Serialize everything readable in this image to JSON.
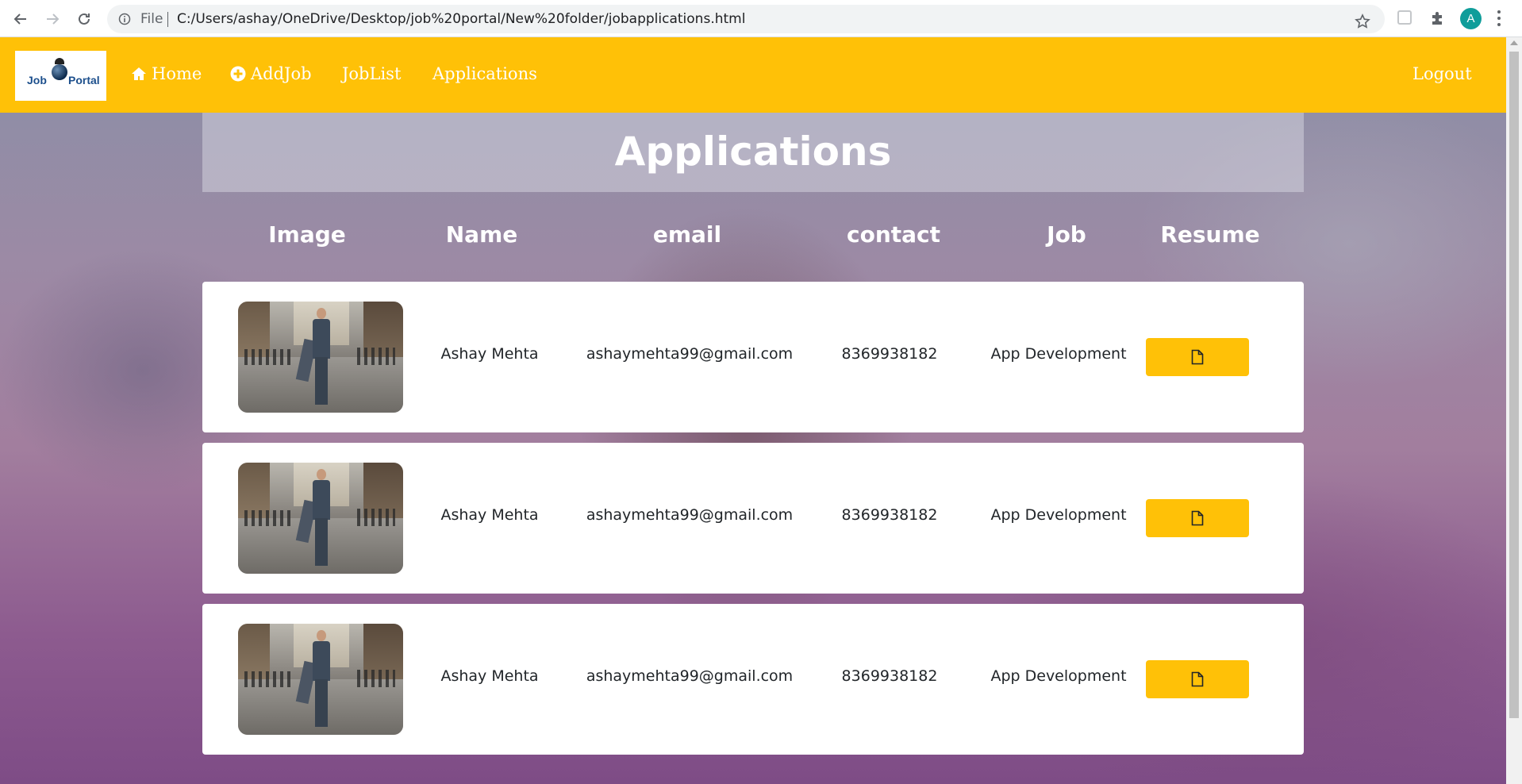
{
  "browser": {
    "file_label": "File",
    "url": "C:/Users/ashay/OneDrive/Desktop/job%20portal/New%20folder/jobapplications.html",
    "profile_initial": "A"
  },
  "navbar": {
    "logo_word1": "Job",
    "logo_word2": "Portal",
    "links": [
      {
        "label": "Home",
        "icon": "home-icon"
      },
      {
        "label": "AddJob",
        "icon": "plus-circle-icon"
      },
      {
        "label": "JobList"
      },
      {
        "label": "Applications"
      }
    ],
    "logout_label": "Logout"
  },
  "page": {
    "title": "Applications"
  },
  "table": {
    "columns": [
      "Image",
      "Name",
      "email",
      "contact",
      "Job",
      "Resume"
    ],
    "rows": [
      {
        "name": "Ashay Mehta",
        "email": "ashaymehta99@gmail.com",
        "contact": "8369938182",
        "job": "App Development"
      },
      {
        "name": "Ashay Mehta",
        "email": "ashaymehta99@gmail.com",
        "contact": "8369938182",
        "job": "App Development"
      },
      {
        "name": "Ashay Mehta",
        "email": "ashaymehta99@gmail.com",
        "contact": "8369938182",
        "job": "App Development"
      }
    ]
  },
  "colors": {
    "navbar": "#ffc107",
    "resume_button": "#ffc107"
  }
}
